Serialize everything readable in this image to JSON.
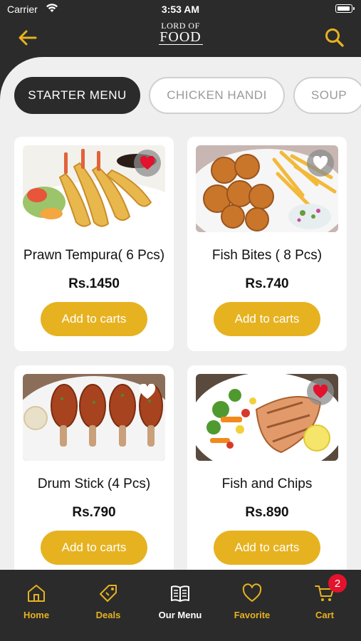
{
  "status_bar": {
    "carrier": "Carrier",
    "time": "3:53 AM"
  },
  "header": {
    "logo_line1": "LORD OF",
    "logo_line2": "FOOD"
  },
  "colors": {
    "accent": "#e6b220",
    "dark": "#2b2b2b",
    "background": "#efefef",
    "favorite_active": "#e3122d"
  },
  "categories": [
    {
      "label": "STARTER MENU",
      "active": true
    },
    {
      "label": "CHICKEN HANDI",
      "active": false
    },
    {
      "label": "SOUP",
      "active": false
    }
  ],
  "menu_items": [
    {
      "name": "Prawn Tempura( 6 Pcs)",
      "price": "Rs.1450",
      "button": "Add to carts",
      "favorited": true
    },
    {
      "name": "Fish Bites ( 8 Pcs)",
      "price": "Rs.740",
      "button": "Add to carts",
      "favorited": false
    },
    {
      "name": "Drum Stick (4 Pcs)",
      "price": "Rs.790",
      "button": "Add to carts",
      "favorited": false
    },
    {
      "name": "Fish and Chips",
      "price": "Rs.890",
      "button": "Add to carts",
      "favorited": true
    }
  ],
  "tab_bar": {
    "items": [
      {
        "label": "Home",
        "icon": "home-icon"
      },
      {
        "label": "Deals",
        "icon": "tag-icon"
      },
      {
        "label": "Our Menu",
        "icon": "menu-book-icon",
        "active": true
      },
      {
        "label": "Favorite",
        "icon": "heart-icon"
      },
      {
        "label": "Cart",
        "icon": "cart-icon"
      }
    ],
    "cart_count": "2"
  }
}
